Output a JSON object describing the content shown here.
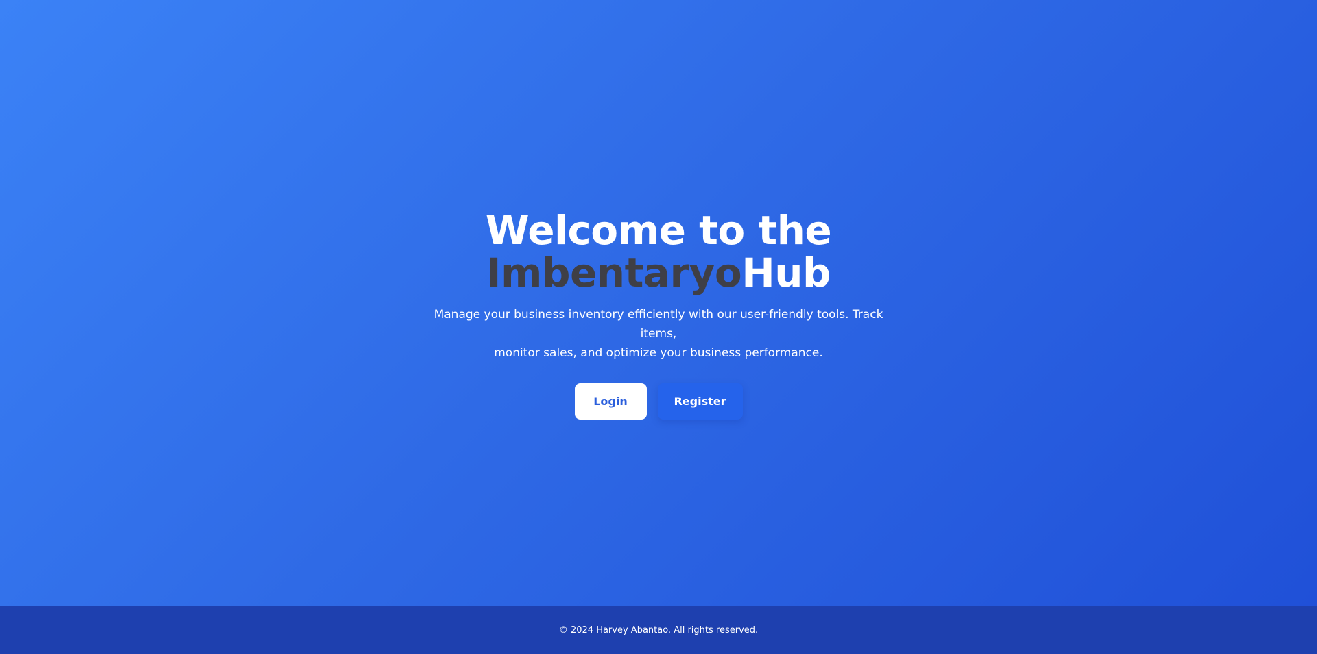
{
  "hero": {
    "headline_line1": "Welcome to the",
    "brand_part1": "Imbentaryo",
    "brand_part2": "Hub",
    "subtitle_line1": "Manage your business inventory efficiently with our user-friendly tools. Track items,",
    "subtitle_line2": "monitor sales, and optimize your business performance.",
    "buttons": {
      "login_label": "Login",
      "register_label": "Register"
    }
  },
  "footer": {
    "copyright": "© 2024 Harvey Abantao. All rights reserved."
  },
  "colors": {
    "background_start": "#3b82f6",
    "background_end": "#1f4fd7",
    "brand_dark": "#3f3f46",
    "register_button": "#2563eb",
    "footer": "#1e40af"
  }
}
